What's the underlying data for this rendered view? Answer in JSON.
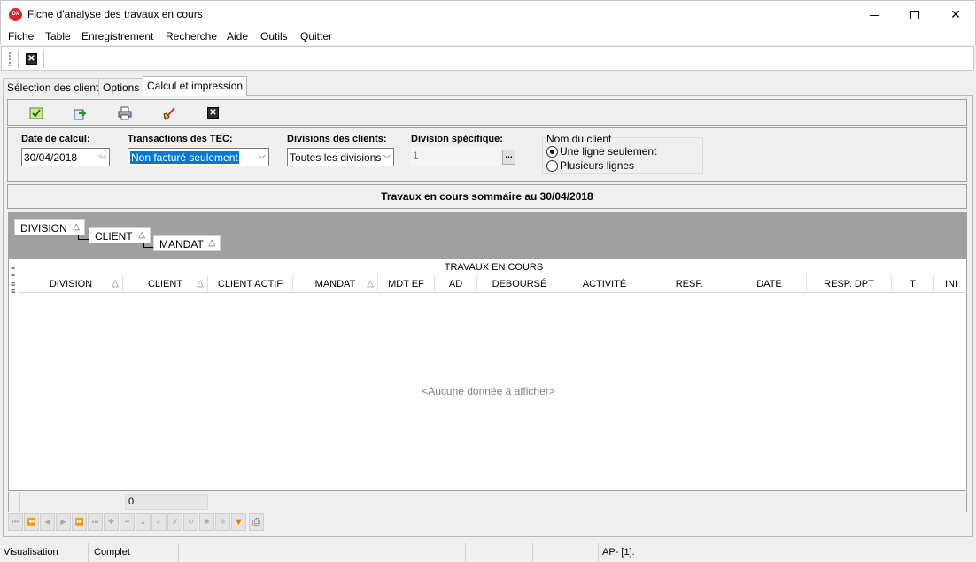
{
  "window": {
    "title": "Fiche d'analyse des travaux en cours",
    "app_icon_text": "DX",
    "close_glyph": "✕"
  },
  "menu": {
    "items": [
      "Fiche",
      "Table",
      "Enregistrement",
      "Recherche",
      "Aide",
      "Outils",
      "Quitter"
    ]
  },
  "tabs": [
    {
      "label": "Sélection des clients",
      "active": false
    },
    {
      "label": "Options",
      "active": false
    },
    {
      "label": "Calcul et impression",
      "active": true
    }
  ],
  "form": {
    "date_label": "Date de calcul:",
    "date_value": "30/04/2018",
    "tec_label": "Transactions des TEC:",
    "tec_value": "Non facturé seulement",
    "divisions_label": "Divisions des clients:",
    "divisions_value": "Toutes les divisions",
    "specific_label": "Division spécifique:",
    "specific_value": "1",
    "ellipsis": "...",
    "client_name_group": "Nom du client",
    "radio_one_line": "Une ligne seulement",
    "radio_multi_line": "Plusieurs lignes",
    "selected_option": "Une ligne seulement"
  },
  "summary_title": "Travaux en cours sommaire au 30/04/2018",
  "group_by": [
    "DIVISION",
    "CLIENT",
    "MANDAT"
  ],
  "grid": {
    "band_title": "TRAVAUX EN COURS",
    "columns": [
      "DIVISION",
      "CLIENT",
      "CLIENT ACTIF",
      "MANDAT",
      "MDT EF",
      "AD",
      "DEBOURSÉ",
      "ACTIVITÉ",
      "RESP.",
      "DATE",
      "RESP. DPT",
      "T",
      "INI"
    ],
    "empty_text": "<Aucune donnée à afficher>",
    "footer_value": "0"
  },
  "status": {
    "mode": "Visualisation",
    "state": "Complet",
    "info": "AP- [1]."
  },
  "colors": {
    "selection": "#0078d7",
    "group_area": "#a0a0a0",
    "app_icon": "#d9262e"
  }
}
